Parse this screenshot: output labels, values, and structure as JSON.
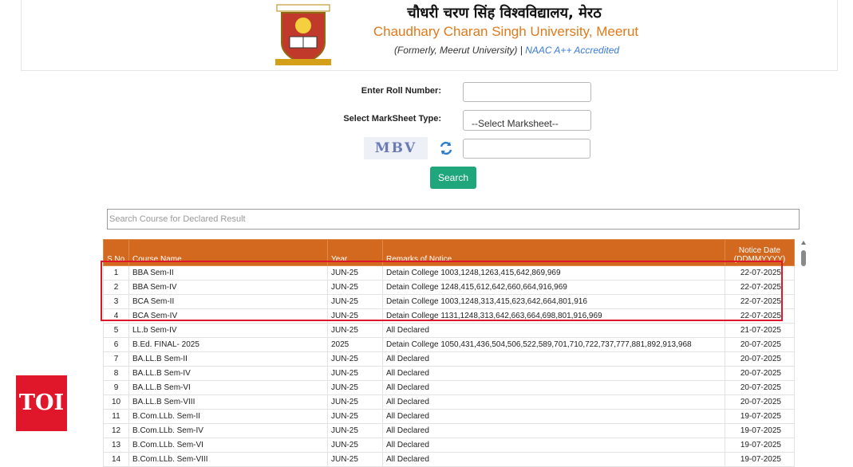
{
  "header": {
    "title_hindi": "चौधरी चरण सिंह विश्वविद्यालय, मेरठ",
    "title_english": "Chaudhary Charan Singh University, Meerut",
    "subtitle_formerly": "(Formerly, Meerut University) |",
    "subtitle_naac": "NAAC A++ Accredited"
  },
  "form": {
    "roll_label": "Enter Roll Number:",
    "roll_value": "",
    "marksheet_label": "Select MarkSheet Type:",
    "marksheet_selected": "--Select Marksheet--",
    "captcha_text": "MBV",
    "captcha_value": "",
    "search_button": "Search"
  },
  "course_search": {
    "placeholder": "Search Course for Declared Result"
  },
  "table": {
    "headers": [
      "S.No.",
      "Course Name",
      "Year",
      "Remarks of Notice",
      "Notice Date (DDMMYYYY)"
    ],
    "rows": [
      [
        "1",
        "BBA Sem-II",
        "JUN-25",
        "Detain College 1003,1248,1263,415,642,869,969",
        "22-07-2025"
      ],
      [
        "2",
        "BBA Sem-IV",
        "JUN-25",
        "Detain College 1248,415,612,642,660,664,916,969",
        "22-07-2025"
      ],
      [
        "3",
        "BCA Sem-II",
        "JUN-25",
        "Detain College 1003,1248,313,415,623,642,664,801,916",
        "22-07-2025"
      ],
      [
        "4",
        "BCA Sem-IV",
        "JUN-25",
        "Detain College 1131,1248,313,642,663,664,698,801,916,969",
        "22-07-2025"
      ],
      [
        "5",
        "LL.b Sem-IV",
        "JUN-25",
        "All Declared",
        "21-07-2025"
      ],
      [
        "6",
        "B.Ed. FINAL- 2025",
        "2025",
        "Detain College 1050,431,436,504,506,522,589,701,710,722,737,777,881,892,913,968",
        "20-07-2025"
      ],
      [
        "7",
        "BA.LL.B Sem-II",
        "JUN-25",
        "All Declared",
        "20-07-2025"
      ],
      [
        "8",
        "BA.LL.B Sem-IV",
        "JUN-25",
        "All Declared",
        "20-07-2025"
      ],
      [
        "9",
        "BA.LL.B Sem-VI",
        "JUN-25",
        "All Declared",
        "20-07-2025"
      ],
      [
        "10",
        "BA.LL.B Sem-VIII",
        "JUN-25",
        "All Declared",
        "20-07-2025"
      ],
      [
        "11",
        "B.Com.LLb. Sem-II",
        "JUN-25",
        "All Declared",
        "19-07-2025"
      ],
      [
        "12",
        "B.Com.LLb. Sem-IV",
        "JUN-25",
        "All Declared",
        "19-07-2025"
      ],
      [
        "13",
        "B.Com.LLb. Sem-VI",
        "JUN-25",
        "All Declared",
        "19-07-2025"
      ],
      [
        "14",
        "B.Com.LLb. Sem-VIII",
        "JUN-25",
        "All Declared",
        "19-07-2025"
      ]
    ]
  },
  "watermark": {
    "text": "TOI"
  },
  "colors": {
    "accent": "#d3681f",
    "button": "#1fa67a",
    "highlight": "#e0162b",
    "link": "#3a7bd5"
  },
  "icons": {
    "logo": "university-crest",
    "refresh": "refresh-icon"
  }
}
